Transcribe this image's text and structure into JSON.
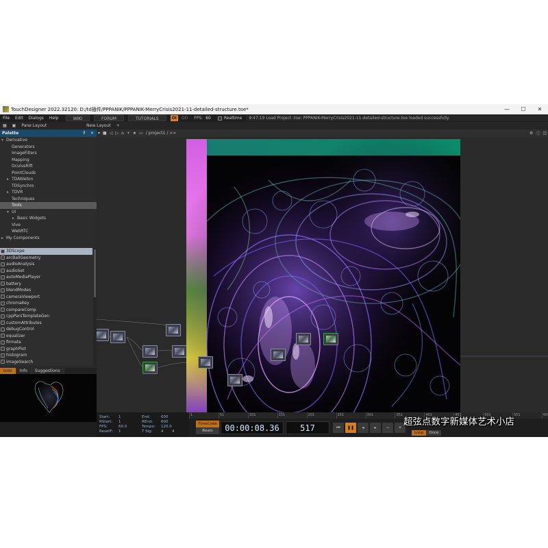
{
  "window": {
    "title": "TouchDesigner 2022.32120: D:/td插件/PPPANIK/PPPANIK-MerryCrisis2021-11-detailed-structure.toe*",
    "minimize": "—",
    "maximize": "☐",
    "close": "✕"
  },
  "menu": {
    "items": [
      "File",
      "Edit",
      "Dialogs",
      "Help"
    ],
    "wiki": "WIKI",
    "forum": "FORUM",
    "tutorials": "TUTORIALS",
    "oi": "OI",
    "gray": "OD",
    "fps_label": "FPS:",
    "fps_value": "60",
    "realtime": "Realtime",
    "status": "9:47:19 Load Project .toe: PPPANIK-MerryCrisis2021-11-detailed-structure.toe loaded successfully."
  },
  "toolbar": {
    "pane_layout": "Pane Layout",
    "new_layout": "New Layout",
    "add": "+"
  },
  "palette": {
    "title": "Palette",
    "help": "?",
    "close": "✕",
    "tree": [
      {
        "label": "Derivative",
        "indent": 0,
        "toggle": "▾"
      },
      {
        "label": "Generators",
        "indent": 1,
        "toggle": ""
      },
      {
        "label": "ImageFilters",
        "indent": 1,
        "toggle": ""
      },
      {
        "label": "Mapping",
        "indent": 1,
        "toggle": ""
      },
      {
        "label": "OculusRift",
        "indent": 1,
        "toggle": ""
      },
      {
        "label": "PointClouds",
        "indent": 1,
        "toggle": ""
      },
      {
        "label": "TDAbleton",
        "indent": 1,
        "toggle": "▸"
      },
      {
        "label": "TDSynchro",
        "indent": 1,
        "toggle": ""
      },
      {
        "label": "TDVR",
        "indent": 1,
        "toggle": "▸"
      },
      {
        "label": "Techniques",
        "indent": 1,
        "toggle": ""
      },
      {
        "label": "Tools",
        "indent": 1,
        "toggle": "",
        "selected": true
      },
      {
        "label": "UI",
        "indent": 1,
        "toggle": "▾"
      },
      {
        "label": "Basic Widgets",
        "indent": 2,
        "toggle": "▸"
      },
      {
        "label": "Vive",
        "indent": 1,
        "toggle": ""
      },
      {
        "label": "WebRTC",
        "indent": 1,
        "toggle": ""
      },
      {
        "label": "My Components",
        "indent": 0,
        "toggle": "▸"
      }
    ],
    "components": [
      "3DScope",
      "arcBallGeometry",
      "audioAnalysis",
      "audioSet",
      "autoMediaPlayer",
      "battery",
      "blendModes",
      "cameraViewport",
      "chromaKey",
      "compareComp",
      "cppParsTemplateGen",
      "customAttributes",
      "debugControl",
      "equalizer",
      "firmata",
      "graphPlot",
      "histogram",
      "imageSearch"
    ],
    "tabs": [
      "Icon",
      "Info",
      "Suggestions"
    ]
  },
  "network": {
    "path": "/ project1 / >>"
  },
  "timeline": {
    "info": {
      "start_label": "Start:",
      "start": "1",
      "rstart_label": "RStart:",
      "rstart": "1",
      "fps_label": "FPS:",
      "fps": "60.0",
      "resetf_label": "ResetF:",
      "resetf": "1",
      "end_label": "End:",
      "end": "600",
      "rend_label": "REnd:",
      "rend": "600",
      "tempo_label": "Tempo:",
      "tempo": "120.0",
      "tsig_label": "T Sig:",
      "tsig_a": "4",
      "tsig_b": "4"
    },
    "ruler": [
      "1",
      "51",
      "101",
      "151",
      "201",
      "251",
      "301",
      "351",
      "401",
      "451",
      "501",
      "551",
      "600"
    ],
    "timecode_label": "TimeCode",
    "beats_label": "Beats",
    "timecode": "00:00:08.36",
    "frame": "517",
    "loop": "Loop",
    "once": "Once"
  },
  "watermark": "超弦点数字新媒体艺术小店"
}
